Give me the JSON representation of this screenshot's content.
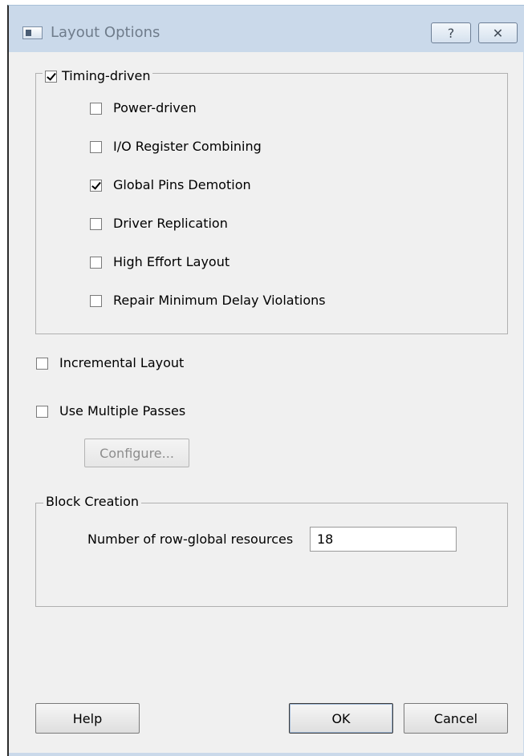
{
  "window": {
    "title": "Layout Options",
    "help_button": "?",
    "close_button": "✕"
  },
  "timing_group": {
    "label": "Timing-driven",
    "checked": true,
    "options": [
      {
        "label": "Power-driven",
        "checked": false
      },
      {
        "label": "I/O Register Combining",
        "checked": false
      },
      {
        "label": "Global Pins Demotion",
        "checked": true
      },
      {
        "label": "Driver Replication",
        "checked": false
      },
      {
        "label": "High Effort Layout",
        "checked": false
      },
      {
        "label": "Repair Minimum Delay Violations",
        "checked": false
      }
    ]
  },
  "incremental_layout": {
    "label": "Incremental Layout",
    "checked": false
  },
  "multiple_passes": {
    "label": "Use Multiple Passes",
    "checked": false
  },
  "configure_button": "Configure...",
  "block_creation": {
    "label": "Block Creation",
    "row_global_label": "Number of row-global resources",
    "row_global_value": "18"
  },
  "buttons": {
    "help": "Help",
    "ok": "OK",
    "cancel": "Cancel"
  }
}
